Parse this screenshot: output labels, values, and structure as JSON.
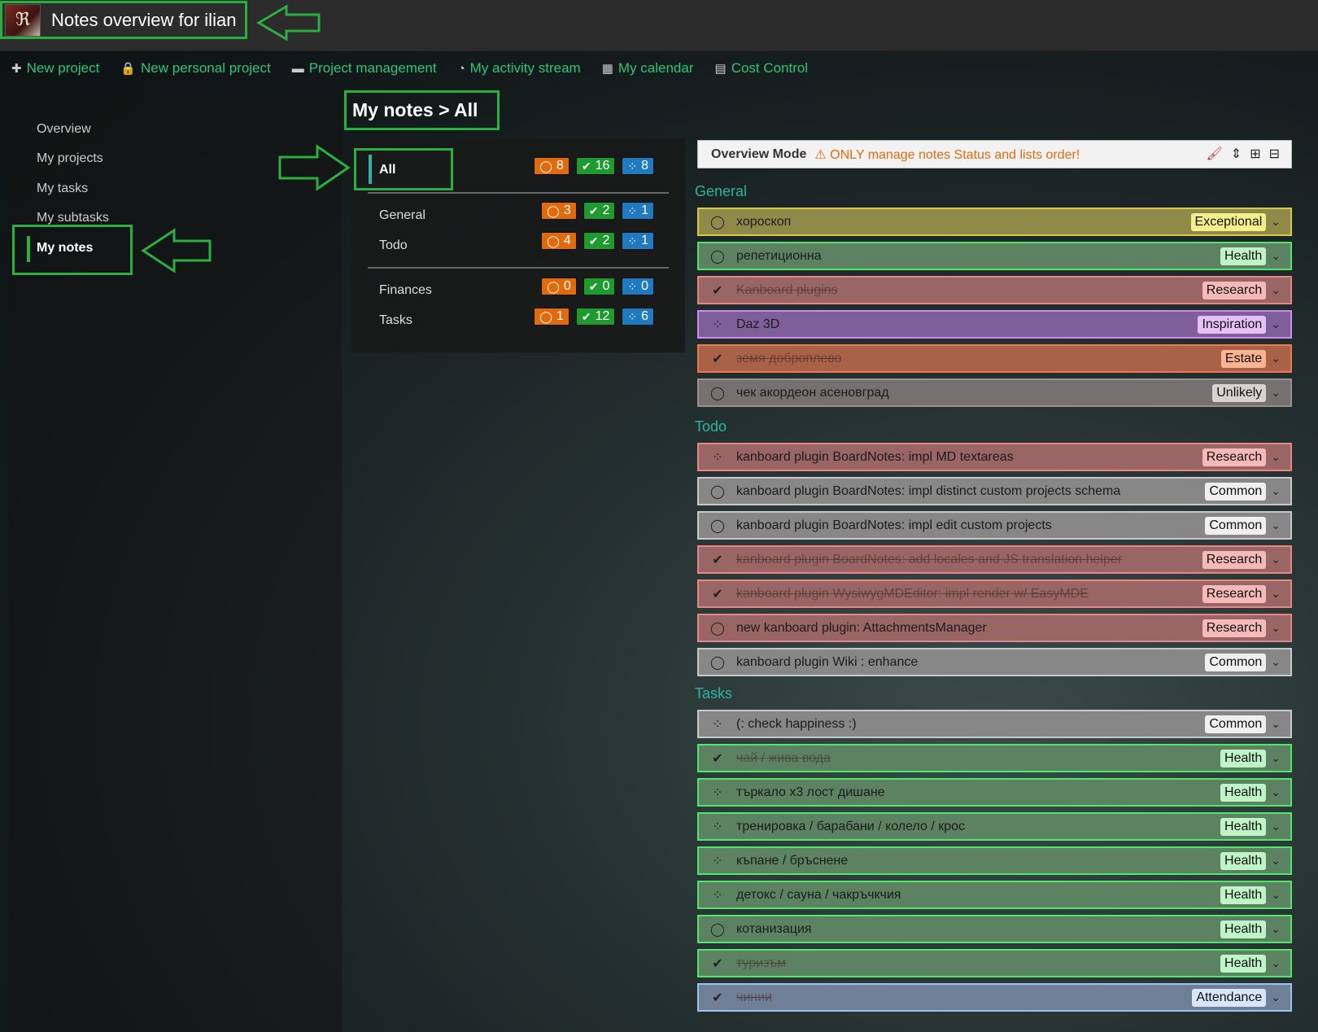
{
  "header": {
    "title": "Notes overview for ilian",
    "logo_icon": "app-logo"
  },
  "nav": [
    {
      "icon": "✚",
      "label": "New project"
    },
    {
      "icon": "🔒",
      "label": "New personal project"
    },
    {
      "icon": "▬",
      "label": "Project management"
    },
    {
      "icon": "◔",
      "label": "My activity stream"
    },
    {
      "icon": "▦",
      "label": "My calendar"
    },
    {
      "icon": "▤",
      "label": "Cost Control"
    }
  ],
  "sidebar": {
    "items": [
      "Overview",
      "My projects",
      "My tasks",
      "My subtasks"
    ],
    "active": "My notes"
  },
  "page": {
    "title": "My notes > All"
  },
  "categories": {
    "all": {
      "label": "All",
      "open": "8",
      "done": "16",
      "progress": "8"
    },
    "projects": [
      {
        "label": "General",
        "open": "3",
        "done": "2",
        "progress": "1"
      },
      {
        "label": "Todo",
        "open": "4",
        "done": "2",
        "progress": "1"
      }
    ],
    "others": [
      {
        "label": "Finances",
        "open": "0",
        "done": "0",
        "progress": "0"
      },
      {
        "label": "Tasks",
        "open": "1",
        "done": "12",
        "progress": "6"
      }
    ]
  },
  "overview": {
    "label": "Overview Mode",
    "warning": "⚠ ONLY manage notes Status and lists order!"
  },
  "groups": [
    {
      "title": "General",
      "notes": [
        {
          "text": "хороскоп",
          "tag": "Exceptional",
          "status": "open"
        },
        {
          "text": "репетиционна",
          "tag": "Health",
          "status": "open"
        },
        {
          "text": "Kanboard plugins",
          "tag": "Research",
          "status": "done"
        },
        {
          "text": "Daz 3D",
          "tag": "Inspiration",
          "status": "progress"
        },
        {
          "text": "земя доброплево",
          "tag": "Estate",
          "status": "done"
        },
        {
          "text": "чек акордеон асеновград",
          "tag": "Unlikely",
          "status": "open"
        }
      ]
    },
    {
      "title": "Todo",
      "notes": [
        {
          "text": "kanboard plugin BoardNotes: impl MD textareas",
          "tag": "Research",
          "status": "progress"
        },
        {
          "text": "kanboard plugin BoardNotes: impl distinct custom projects schema",
          "tag": "Common",
          "status": "open"
        },
        {
          "text": "kanboard plugin BoardNotes: impl edit custom projects",
          "tag": "Common",
          "status": "open"
        },
        {
          "text": "kanboard plugin BoardNotes: add locales and JS translation helper",
          "tag": "Research",
          "status": "done"
        },
        {
          "text": "kanboard plugin WysiwygMDEditor: impl render w/ EasyMDE",
          "tag": "Research",
          "status": "done"
        },
        {
          "text": "new kanboard plugin: AttachmentsManager",
          "tag": "Research",
          "status": "open"
        },
        {
          "text": "kanboard plugin Wiki : enhance",
          "tag": "Common",
          "status": "open"
        }
      ]
    },
    {
      "title": "Tasks",
      "notes": [
        {
          "text": "(: check happiness :)",
          "tag": "Common",
          "status": "progress"
        },
        {
          "text": "чай / жива вода",
          "tag": "Health",
          "status": "done"
        },
        {
          "text": "търкало x3 лост дишане",
          "tag": "Health",
          "status": "progress"
        },
        {
          "text": "тренировка / барабани / колело / крос",
          "tag": "Health",
          "status": "progress"
        },
        {
          "text": "къпане / бръснене",
          "tag": "Health",
          "status": "progress"
        },
        {
          "text": "детокс / сауна / чакръчкчия",
          "tag": "Health",
          "status": "progress"
        },
        {
          "text": "котанизация",
          "tag": "Health",
          "status": "open"
        },
        {
          "text": "туризъм",
          "tag": "Health",
          "status": "done"
        },
        {
          "text": "чинии",
          "tag": "Attendance",
          "status": "done"
        }
      ]
    }
  ]
}
